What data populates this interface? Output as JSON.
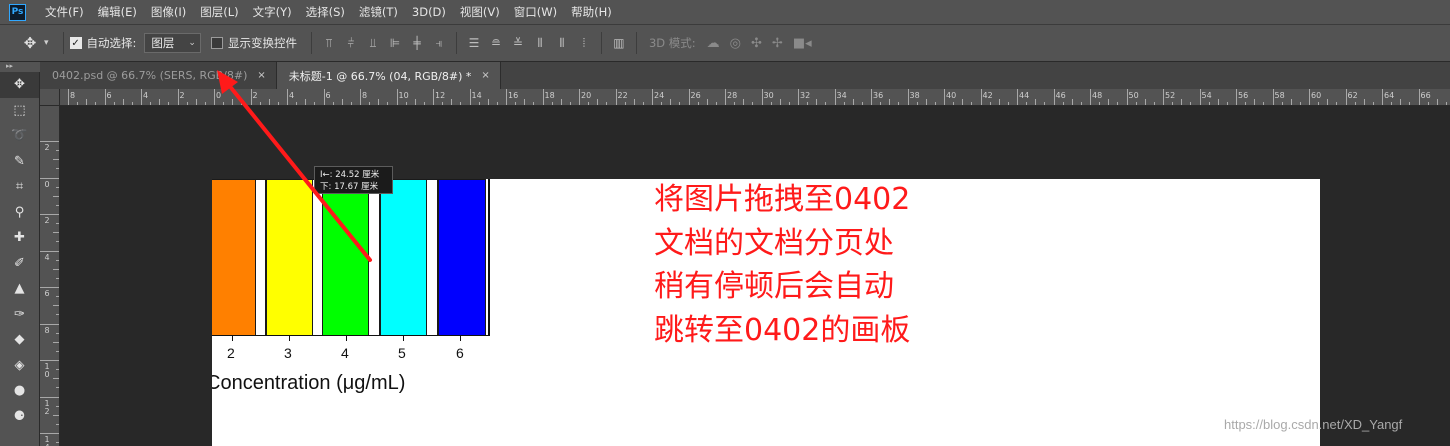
{
  "app": {
    "logo_text": "Ps"
  },
  "menu": [
    "文件(F)",
    "编辑(E)",
    "图像(I)",
    "图层(L)",
    "文字(Y)",
    "选择(S)",
    "滤镜(T)",
    "3D(D)",
    "视图(V)",
    "窗口(W)",
    "帮助(H)"
  ],
  "options": {
    "auto_select_label": "自动选择:",
    "auto_select_checked": true,
    "target_value": "图层",
    "show_transform_label": "显示变换控件",
    "show_transform_checked": false,
    "mode_3d_label": "3D 模式:"
  },
  "tabs": [
    {
      "label": "0402.psd @ 66.7% (SERS, RGB/8#)",
      "close": "×",
      "active": false
    },
    {
      "label": "未标题-1 @ 66.7% (04, RGB/8#) *",
      "close": "×",
      "active": true
    }
  ],
  "ruler": {
    "h_labels": [
      "8",
      "6",
      "4",
      "2",
      "0",
      "2",
      "4",
      "6",
      "8",
      "10",
      "12",
      "14",
      "16",
      "18",
      "20",
      "22",
      "24",
      "26",
      "28",
      "30",
      "32",
      "34",
      "36",
      "38",
      "40",
      "42",
      "44",
      "46",
      "48",
      "50",
      "52",
      "54",
      "56",
      "58",
      "60",
      "62",
      "64",
      "66"
    ],
    "v_labels": [
      "2",
      "0",
      "2",
      "4",
      "6",
      "8",
      "1 0",
      "1 2",
      "1 4"
    ]
  },
  "tooltip": {
    "line1": "I←: 24.52 厘米",
    "line2": "下: 17.67 厘米"
  },
  "chart": {
    "ticks": [
      "2",
      "3",
      "4",
      "5",
      "6"
    ],
    "axis_title": "Concentration (μg/mL)",
    "bar_colors": [
      "#ff8000",
      "#ffffff",
      "#ffff00",
      "#ffffff",
      "#00ff00",
      "#ffffff",
      "#00ffff",
      "#ffffff",
      "#0000ff"
    ]
  },
  "annotation": [
    "将图片拖拽至0402",
    "文档的文档分页处",
    "稍有停顿后会自动",
    "跳转至0402的画板"
  ],
  "watermark": "https://blog.csdn.net/XD_Yangf",
  "colors": {
    "annotation_red": "#ff1a1a",
    "arrow_red": "#ff1a1a"
  }
}
